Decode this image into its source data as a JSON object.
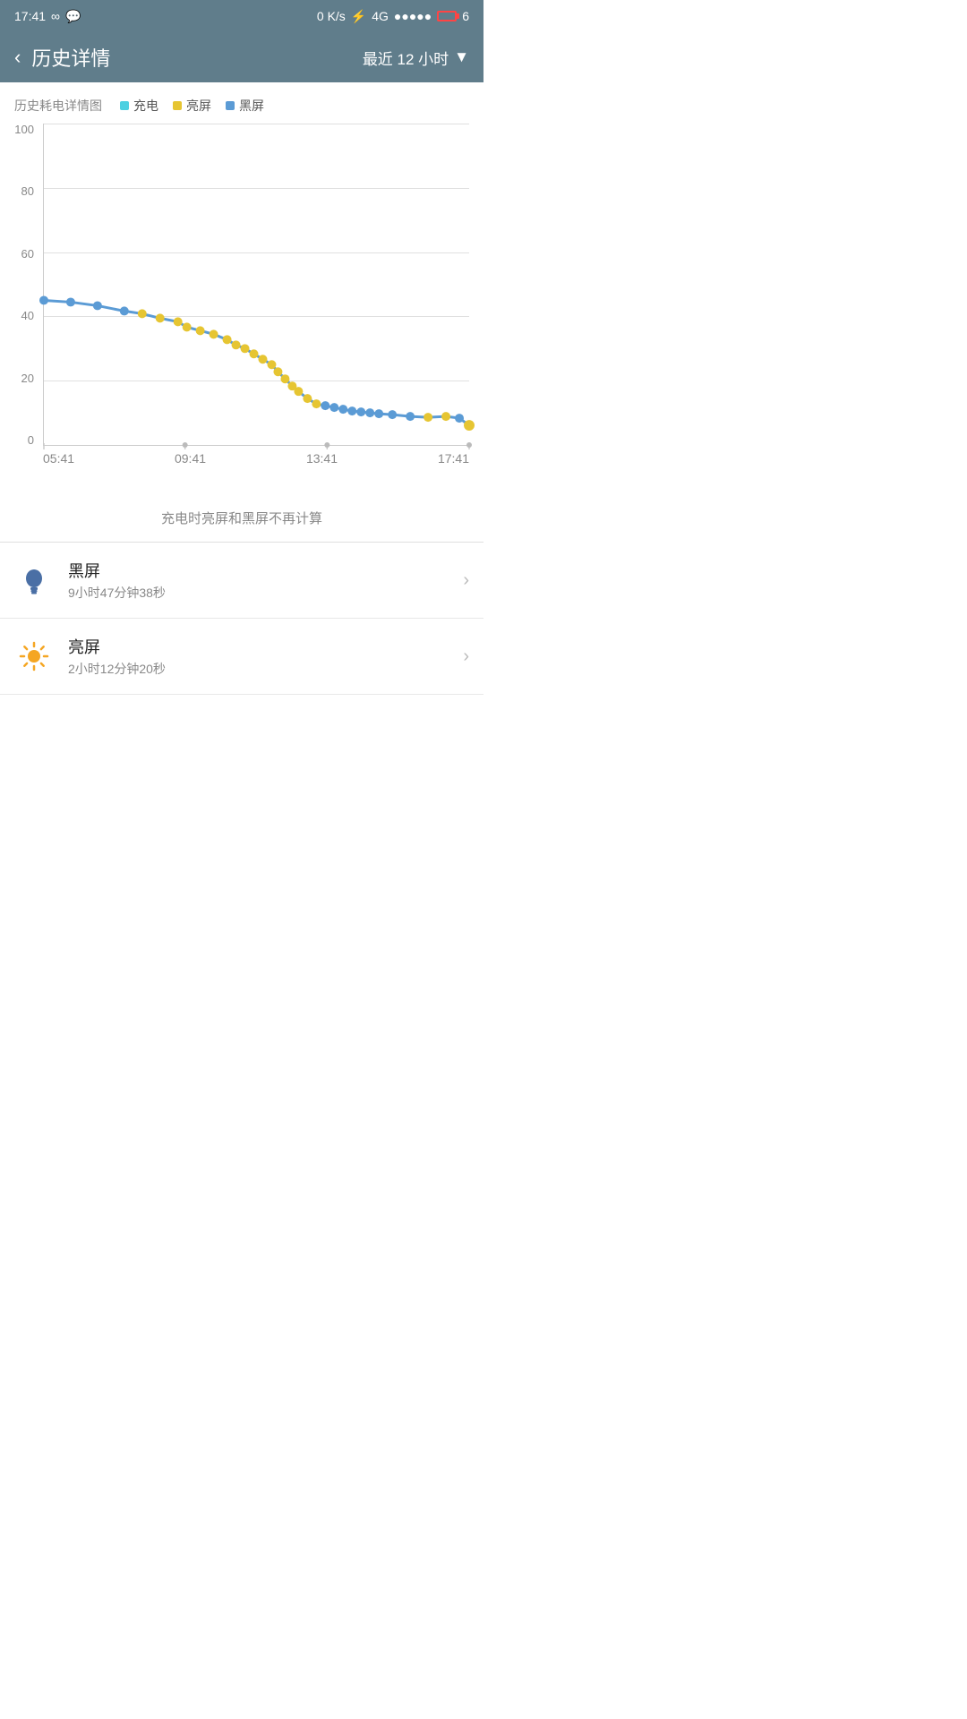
{
  "statusBar": {
    "time": "17:41",
    "signal": "0 K/s",
    "network": "4G",
    "batteryNum": "6"
  },
  "header": {
    "backLabel": "‹",
    "title": "历史详情",
    "filterLabel": "最近 12 小时",
    "dropdownIcon": "▼"
  },
  "chart": {
    "legendTitle": "历史耗电详情图",
    "legendItems": [
      {
        "label": "充电",
        "color": "#4dd0e1"
      },
      {
        "label": "亮屏",
        "color": "#e6c532"
      },
      {
        "label": "黑屏",
        "color": "#5b9bd5"
      }
    ],
    "yLabels": [
      "100",
      "80",
      "60",
      "40",
      "20",
      "0"
    ],
    "xLabels": [
      "05:41",
      "09:41",
      "13:41",
      "17:41"
    ],
    "note": "充电时亮屏和黑屏不再计算"
  },
  "listItems": [
    {
      "iconType": "bulb",
      "title": "黑屏",
      "sub": "9小时47分钟38秒"
    },
    {
      "iconType": "sun",
      "title": "亮屏",
      "sub": "2小时12分钟20秒"
    }
  ]
}
